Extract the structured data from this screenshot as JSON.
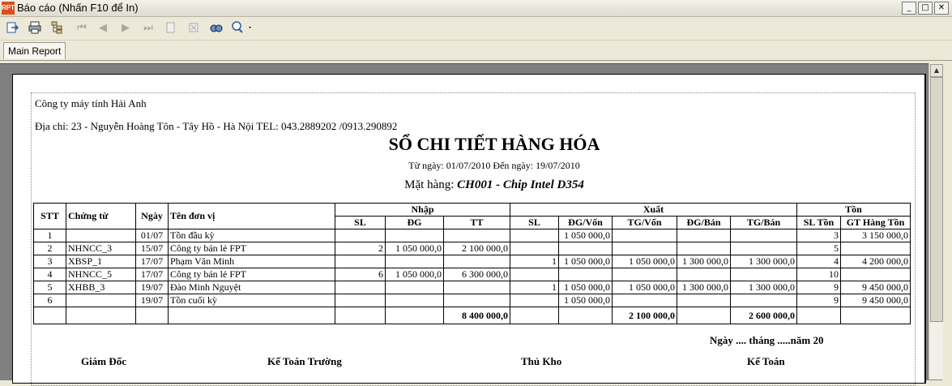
{
  "window": {
    "icon_text": "RPT",
    "title": "Báo cáo (Nhấn F10 để In)",
    "buttons": [
      "_",
      "□",
      "✕"
    ]
  },
  "toolbar": {
    "icons": [
      "export-icon",
      "print-icon",
      "group-tree-icon",
      "first-page-icon",
      "prev-page-icon",
      "next-page-icon",
      "last-page-icon",
      "goto-page-icon",
      "stop-icon",
      "search-icon",
      "zoom-icon"
    ]
  },
  "tabs": {
    "main_report": "Main Report"
  },
  "report": {
    "company": "Công ty máy tính Hải Anh",
    "address": "Địa chỉ: 23 - Nguyễn Hoàng Tôn - Tây Hồ - Hà Nội TEL: 043.2889202 /0913.290892",
    "title": "SỔ CHI TIẾT HÀNG HÓA",
    "date_range": "Từ ngày: 01/07/2010 Đến ngày: 19/07/2010",
    "item_label": "Mặt hàng: ",
    "item_value": "CH001 - Chip Intel D354",
    "headers": {
      "stt": "STT",
      "chung_tu": "Chứng từ",
      "ngay": "Ngày",
      "ten_don_vi": "Tên đơn vị",
      "nhap": "Nhập",
      "xuat": "Xuất",
      "ton": "Tồn",
      "nhap_sl": "SL",
      "nhap_dg": "ĐG",
      "nhap_tt": "TT",
      "xuat_sl": "SL",
      "xuat_dgvon": "ĐG/Vốn",
      "xuat_tgvon": "TG/Vốn",
      "xuat_dgban": "ĐG/Bán",
      "xuat_tgban": "TG/Bán",
      "ton_sl": "SL Tồn",
      "ton_gt": "GT Hàng Tồn"
    },
    "rows": [
      {
        "stt": "1",
        "ct": "",
        "ngay": "01/07",
        "ten": "Tồn đầu kỳ",
        "nsl": "",
        "ndg": "",
        "ntt": "",
        "xsl": "",
        "xdgv": "1 050 000,0",
        "xtgv": "",
        "xdgb": "",
        "xtgb": "",
        "tsl": "3",
        "tgt": "3 150 000,0"
      },
      {
        "stt": "2",
        "ct": "NHNCC_3",
        "ngay": "15/07",
        "ten": "Công ty bán lẻ FPT",
        "nsl": "2",
        "ndg": "1 050 000,0",
        "ntt": "2 100 000,0",
        "xsl": "",
        "xdgv": "",
        "xtgv": "",
        "xdgb": "",
        "xtgb": "",
        "tsl": "5",
        "tgt": ""
      },
      {
        "stt": "3",
        "ct": "XBSP_1",
        "ngay": "17/07",
        "ten": "Phạm Văn Minh",
        "nsl": "",
        "ndg": "",
        "ntt": "",
        "xsl": "1",
        "xdgv": "1 050 000,0",
        "xtgv": "1 050 000,0",
        "xdgb": "1 300 000,0",
        "xtgb": "1 300 000,0",
        "tsl": "4",
        "tgt": "4 200 000,0"
      },
      {
        "stt": "4",
        "ct": "NHNCC_5",
        "ngay": "17/07",
        "ten": "Công ty bán lẻ FPT",
        "nsl": "6",
        "ndg": "1 050 000,0",
        "ntt": "6 300 000,0",
        "xsl": "",
        "xdgv": "",
        "xtgv": "",
        "xdgb": "",
        "xtgb": "",
        "tsl": "10",
        "tgt": ""
      },
      {
        "stt": "5",
        "ct": "XHBB_3",
        "ngay": "19/07",
        "ten": "Đào Minh Nguyệt",
        "nsl": "",
        "ndg": "",
        "ntt": "",
        "xsl": "1",
        "xdgv": "1 050 000,0",
        "xtgv": "1 050 000,0",
        "xdgb": "1 300 000,0",
        "xtgb": "1 300 000,0",
        "tsl": "9",
        "tgt": "9 450 000,0"
      },
      {
        "stt": "6",
        "ct": "",
        "ngay": "19/07",
        "ten": "Tồn cuối kỳ",
        "nsl": "",
        "ndg": "",
        "ntt": "",
        "xsl": "",
        "xdgv": "1 050 000,0",
        "xtgv": "",
        "xdgb": "",
        "xtgb": "",
        "tsl": "9",
        "tgt": "9 450 000,0"
      }
    ],
    "totals": {
      "nhap_tt": "8 400 000,0",
      "xuat_tgvon": "2 100 000,0",
      "xuat_tgban": "2 600 000,0"
    },
    "sign_date": "Ngày .... tháng .....năm 20",
    "signers": [
      "Giám Đốc",
      "Kế Toán Trường",
      "Thủ Kho",
      "Kế Toán"
    ]
  }
}
